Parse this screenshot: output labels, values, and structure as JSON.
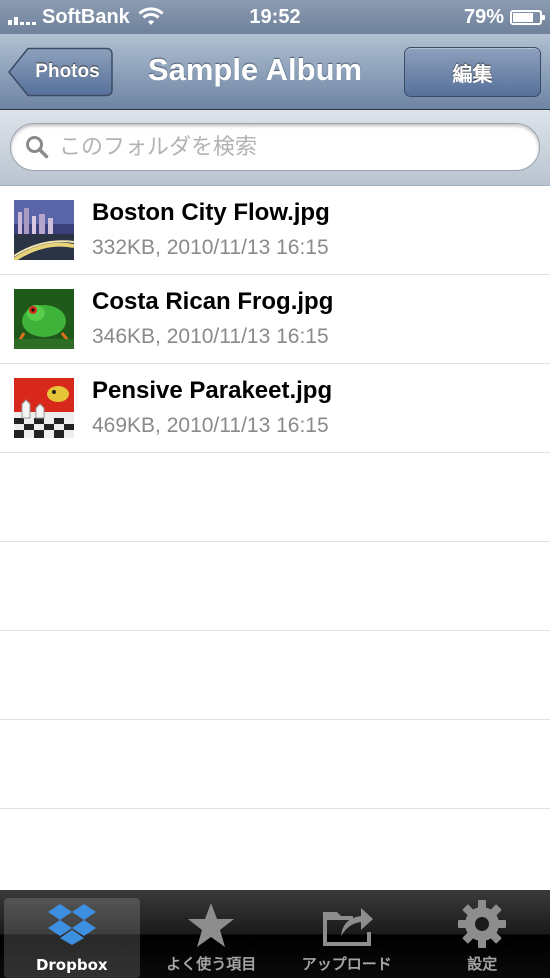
{
  "status_bar": {
    "carrier": "SoftBank",
    "time": "19:52",
    "battery_percent_text": "79%",
    "battery_level": 0.79
  },
  "nav": {
    "back_label": "Photos",
    "title": "Sample Album",
    "edit_label": "編集"
  },
  "search": {
    "placeholder": "このフォルダを検索"
  },
  "files": [
    {
      "name": "Boston City Flow.jpg",
      "meta": "332KB, 2010/11/13 16:15"
    },
    {
      "name": "Costa Rican Frog.jpg",
      "meta": "346KB, 2010/11/13 16:15"
    },
    {
      "name": "Pensive Parakeet.jpg",
      "meta": "469KB, 2010/11/13 16:15"
    }
  ],
  "tabs": [
    {
      "label": "Dropbox",
      "icon": "dropbox-icon",
      "active": true
    },
    {
      "label": "よく使う項目",
      "icon": "star-icon",
      "active": false
    },
    {
      "label": "アップロード",
      "icon": "upload-icon",
      "active": false
    },
    {
      "label": "設定",
      "icon": "gear-icon",
      "active": false
    }
  ],
  "colors": {
    "nav_bar": "#8ea2bb",
    "tab_bar": "#1a1a1a",
    "dropbox_blue": "#3d8fe0",
    "meta_text": "#8a8a8a"
  }
}
